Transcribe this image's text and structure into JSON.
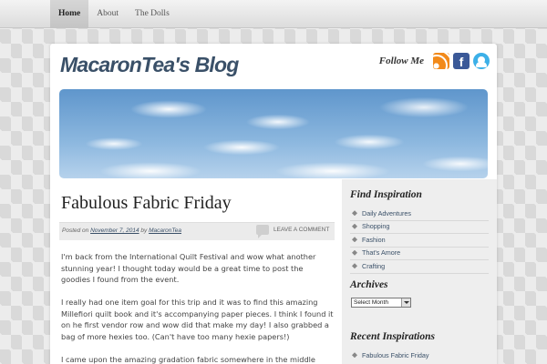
{
  "nav": {
    "items": [
      {
        "label": "Home",
        "active": true
      },
      {
        "label": "About",
        "active": false
      },
      {
        "label": "The Dolls",
        "active": false
      }
    ]
  },
  "header": {
    "blog_title": "MacaronTea's Blog",
    "follow_label": "Follow Me",
    "social": [
      {
        "icon": "rss-icon"
      },
      {
        "icon": "facebook-icon",
        "glyph": "f"
      },
      {
        "icon": "twitter-icon"
      }
    ]
  },
  "post": {
    "title": "Fabulous Fabric Friday",
    "posted_prefix": "Posted on",
    "date": "November 7, 2014",
    "by": "by",
    "author": "MacaronTea",
    "comment_link": "LEAVE A COMMENT",
    "paragraphs": [
      "I'm back from the International Quilt Festival and wow what another stunning year! I thought today would be a great time to post the goodies I found from the event.",
      "I really had one item goal for this trip and it was to find this amazing Millefiori quilt book and it's accompanying paper pieces. I think I found it on he first vendor row and wow did that make my day! I also grabbed a bag of more hexies too. (Can't have too many hexie papers!)",
      "I came upon the amazing gradation fabric somewhere in the middle"
    ]
  },
  "sidebar": {
    "inspiration_title": "Find Inspiration",
    "inspiration_items": [
      "Daily Adventures",
      "Shopping",
      "Fashion",
      "That's Amore",
      "Crafting"
    ],
    "archives_title": "Archives",
    "archives_select": "Select Month",
    "recent_title": "Recent Inspirations",
    "recent_items": [
      "Fabulous Fabric Friday"
    ]
  }
}
